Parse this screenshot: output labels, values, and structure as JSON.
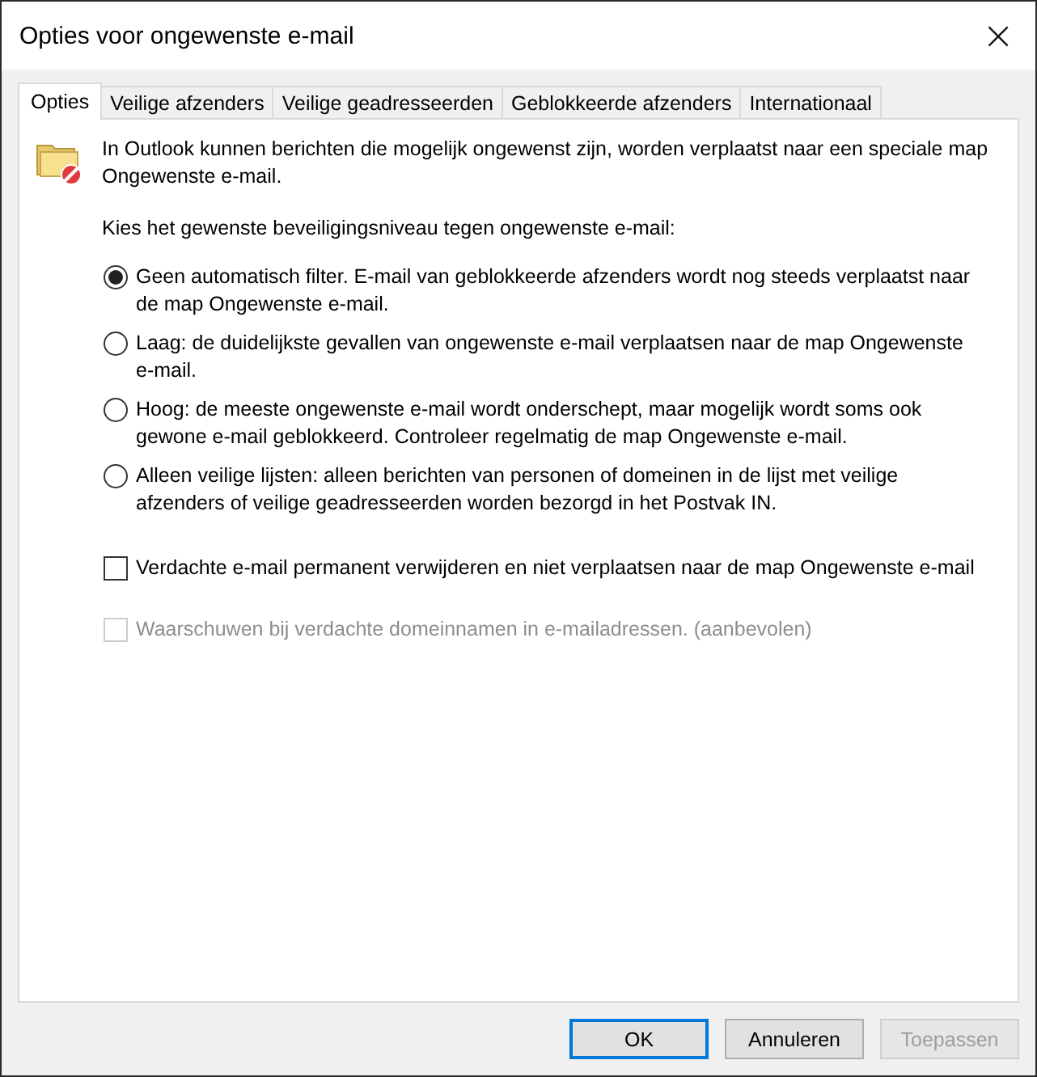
{
  "window": {
    "title": "Opties voor ongewenste e-mail",
    "close": "×"
  },
  "tabs": [
    {
      "label": "Opties",
      "selected": true
    },
    {
      "label": "Veilige afzenders",
      "selected": false
    },
    {
      "label": "Veilige geadresseerden",
      "selected": false
    },
    {
      "label": "Geblokkeerde afzenders",
      "selected": false
    },
    {
      "label": "Internationaal",
      "selected": false
    }
  ],
  "intro": "In Outlook kunnen berichten die mogelijk ongewenst zijn, worden verplaatst naar een speciale map Ongewenste e-mail.",
  "prompt": "Kies het gewenste beveiligingsniveau tegen ongewenste e-mail:",
  "levels": [
    {
      "label": "Geen automatisch filter. E-mail van geblokkeerde afzenders wordt nog steeds verplaatst naar de map Ongewenste e-mail.",
      "selected": true
    },
    {
      "label": "Laag: de duidelijkste gevallen van ongewenste e-mail verplaatsen naar de map Ongewenste e-mail.",
      "selected": false
    },
    {
      "label": "Hoog: de meeste ongewenste e-mail wordt onderschept, maar mogelijk wordt soms ook gewone e-mail geblokkeerd. Controleer regelmatig de map Ongewenste e-mail.",
      "selected": false
    },
    {
      "label": "Alleen veilige lijsten: alleen berichten van personen of domeinen in de lijst met veilige afzenders of veilige geadresseerden worden bezorgd in het Postvak IN.",
      "selected": false
    }
  ],
  "options": [
    {
      "label": "Verdachte e-mail permanent verwijderen en niet verplaatsen naar de map Ongewenste e-mail",
      "checked": false,
      "disabled": false
    },
    {
      "label": "Waarschuwen bij verdachte domeinnamen in e-mailadressen. (aanbevolen)",
      "checked": false,
      "disabled": true
    }
  ],
  "buttons": [
    {
      "label": "OK",
      "kind": "default",
      "disabled": false
    },
    {
      "label": "Annuleren",
      "kind": "normal",
      "disabled": false
    },
    {
      "label": "Toepassen",
      "kind": "normal",
      "disabled": true
    }
  ]
}
